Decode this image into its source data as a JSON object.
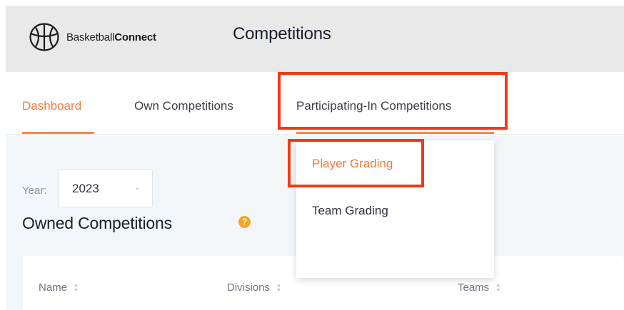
{
  "brand": {
    "name_regular": "Basketball",
    "name_bold": "Connect",
    "logo_icon": "basketball-icon"
  },
  "header": {
    "title": "Competitions"
  },
  "nav": {
    "tabs": [
      {
        "label": "Dashboard",
        "active": true
      },
      {
        "label": "Own Competitions",
        "active": false
      },
      {
        "label": "Participating-In Competitions",
        "active": false
      }
    ]
  },
  "dropdown": {
    "items": [
      {
        "label": "Player Grading",
        "active": true
      },
      {
        "label": "Team Grading",
        "active": false
      }
    ]
  },
  "filters": {
    "year_label": "Year:",
    "year_value": "2023"
  },
  "section": {
    "title": "Owned Competitions",
    "help_icon": "question-icon"
  },
  "table": {
    "columns": [
      "Name",
      "Divisions",
      "Teams"
    ]
  },
  "colors": {
    "accent": "#f07b3f",
    "highlight": "#f03a17",
    "help": "#f5a623"
  }
}
